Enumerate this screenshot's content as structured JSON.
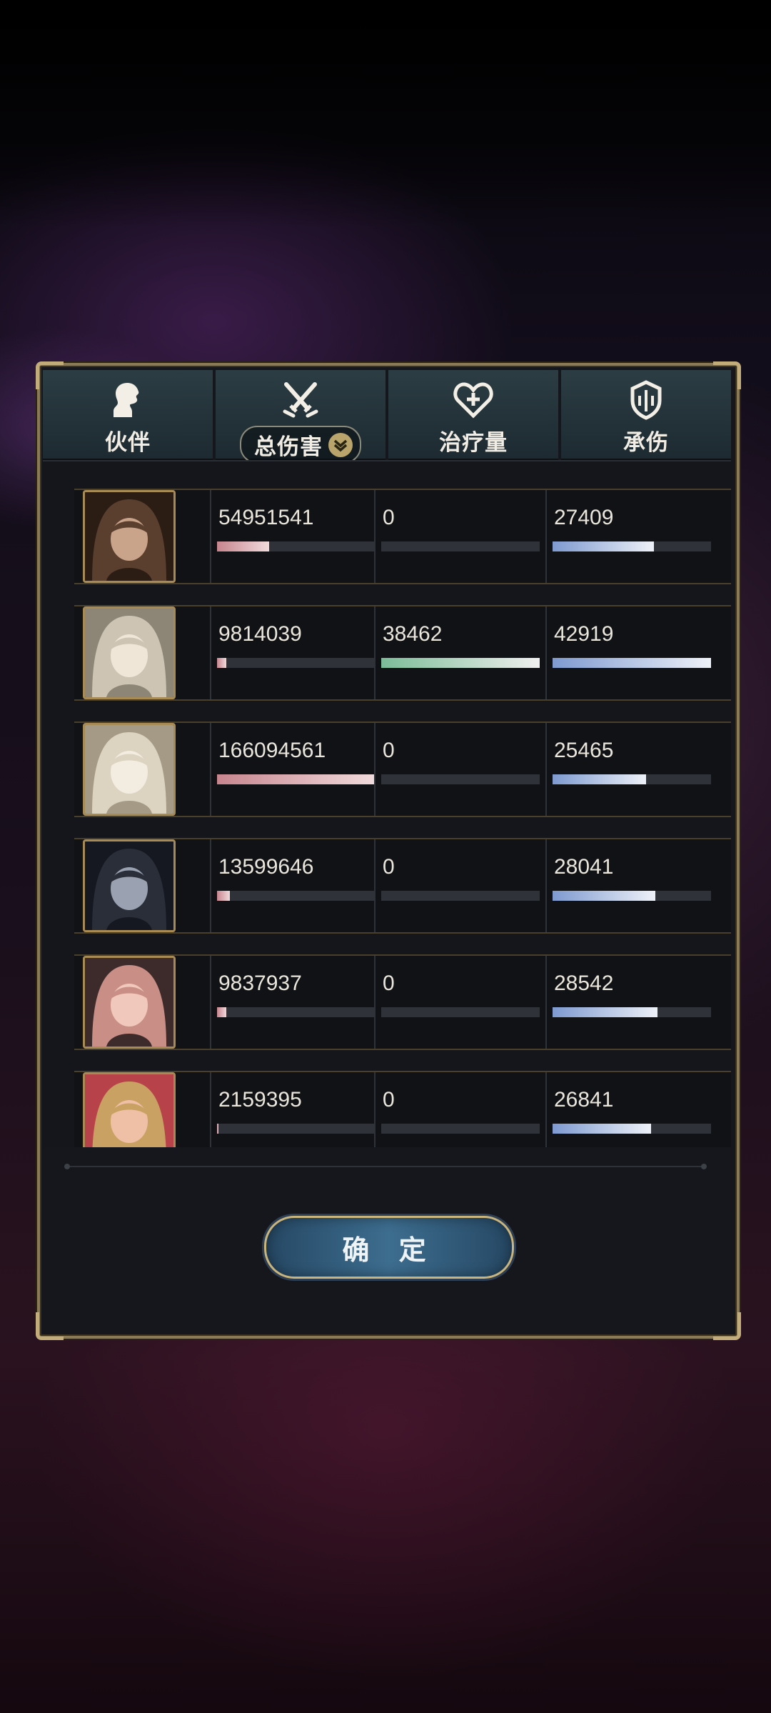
{
  "header": {
    "tabs": [
      {
        "label": "伙伴",
        "icon": "silhouette-icon"
      },
      {
        "label": "总伤害",
        "icon": "crossed-swords-icon",
        "active": true,
        "dropdown_icon": "chevron-down-icon"
      },
      {
        "label": "治疗量",
        "icon": "heart-plus-icon"
      },
      {
        "label": "承伤",
        "icon": "shield-icon"
      }
    ]
  },
  "rows": [
    {
      "damage": "54951541",
      "healing": "0",
      "taken": "27409",
      "damage_pct": 0.33,
      "healing_pct": 0.0,
      "taken_pct": 0.64
    },
    {
      "damage": "9814039",
      "healing": "38462",
      "taken": "42919",
      "damage_pct": 0.06,
      "healing_pct": 1.0,
      "taken_pct": 1.0
    },
    {
      "damage": "166094561",
      "healing": "0",
      "taken": "25465",
      "damage_pct": 1.0,
      "healing_pct": 0.0,
      "taken_pct": 0.59
    },
    {
      "damage": "13599646",
      "healing": "0",
      "taken": "28041",
      "damage_pct": 0.08,
      "healing_pct": 0.0,
      "taken_pct": 0.65
    },
    {
      "damage": "9837937",
      "healing": "0",
      "taken": "28542",
      "damage_pct": 0.06,
      "healing_pct": 0.0,
      "taken_pct": 0.66
    },
    {
      "damage": "2159395",
      "healing": "0",
      "taken": "26841",
      "damage_pct": 0.01,
      "healing_pct": 0.0,
      "taken_pct": 0.62
    }
  ],
  "colors": {
    "damage": "#c7858f",
    "healing": "#7bbd98",
    "taken": "#7e9ad0",
    "frame_gold": "#c2ad7a"
  },
  "confirm_label": "确 定"
}
